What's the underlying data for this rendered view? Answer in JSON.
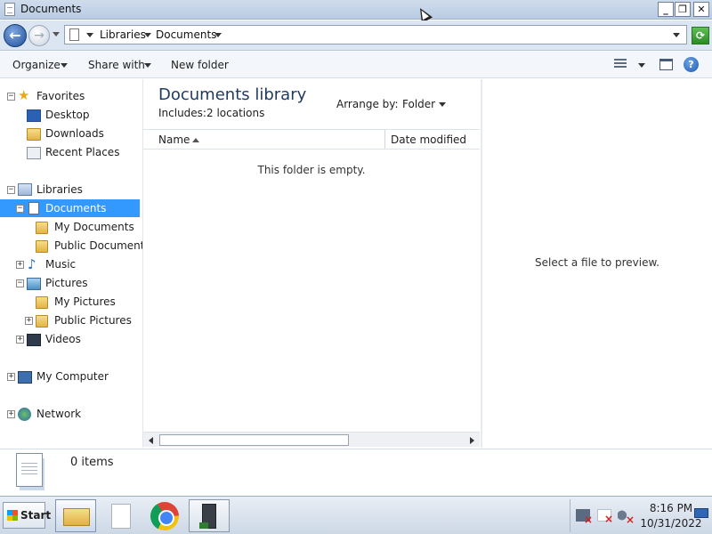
{
  "window": {
    "title": "Documents",
    "minimize_label": "_",
    "maximize_label": "❐",
    "close_label": "✕"
  },
  "navigation": {
    "back_glyph": "←",
    "forward_glyph": "→",
    "breadcrumb": [
      "Libraries",
      "Documents"
    ],
    "refresh_glyph": "⟳"
  },
  "toolbar": {
    "organize": "Organize",
    "share_with": "Share with",
    "new_folder": "New folder",
    "help_glyph": "?"
  },
  "nav_pane": {
    "favorites": {
      "label": "Favorites",
      "expander": "−",
      "items": [
        "Desktop",
        "Downloads",
        "Recent Places"
      ]
    },
    "libraries": {
      "label": "Libraries",
      "expander": "−",
      "documents": {
        "label": "Documents",
        "expander": "−",
        "items": [
          "My Documents",
          "Public Documents"
        ]
      },
      "music": {
        "label": "Music",
        "expander": "+"
      },
      "pictures": {
        "label": "Pictures",
        "expander": "−",
        "items": [
          "My Pictures",
          "Public Pictures"
        ],
        "public_expander": "+"
      },
      "videos": {
        "label": "Videos",
        "expander": "+"
      }
    },
    "computer": {
      "label": "My Computer",
      "expander": "+"
    },
    "network": {
      "label": "Network",
      "expander": "+"
    }
  },
  "content": {
    "library_title": "Documents library",
    "includes_label": "Includes:",
    "includes_link": "2 locations",
    "arrange_by_label": "Arrange by:",
    "arrange_by_value": "Folder",
    "columns": [
      "Name",
      "Date modified"
    ],
    "empty_message": "This folder is empty."
  },
  "preview": {
    "message": "Select a file to preview."
  },
  "details": {
    "item_count": "0 items"
  },
  "taskbar": {
    "start_label": "Start",
    "clock_time": "8:16 PM",
    "clock_date": "10/31/2022"
  },
  "colors": {
    "selection": "#3399ff",
    "titlebar": "#cfdcec",
    "accent_title": "#1e3a5f"
  }
}
